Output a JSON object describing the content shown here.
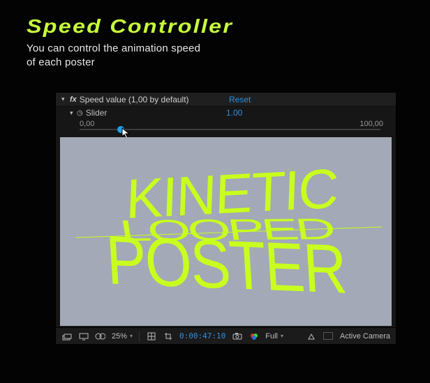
{
  "hero": {
    "title": "Speed Controller",
    "subtitle_l1": "You can control the animation speed",
    "subtitle_l2": "of each poster"
  },
  "effect": {
    "name": "Speed value (1,00 by default)",
    "reset_label": "Reset",
    "property": {
      "name": "Slider",
      "value_display": "1.00",
      "min_label": "0,00",
      "max_label": "100,00"
    }
  },
  "preview": {
    "lines": [
      "KINETIC",
      "LOOPED",
      "POSTER"
    ]
  },
  "toolbar": {
    "zoom": "25%",
    "timecode": "0:00:47:10",
    "channel": "Full",
    "camera": "Active Camera"
  },
  "icons": {
    "layers": "layers-icon",
    "screen": "screen-icon",
    "mask": "mask-icon",
    "grid": "grid-icon",
    "crop": "crop-icon",
    "snapshot": "snapshot-icon",
    "color": "color-icon",
    "render": "render-settings-icon",
    "view": "view-icon"
  }
}
